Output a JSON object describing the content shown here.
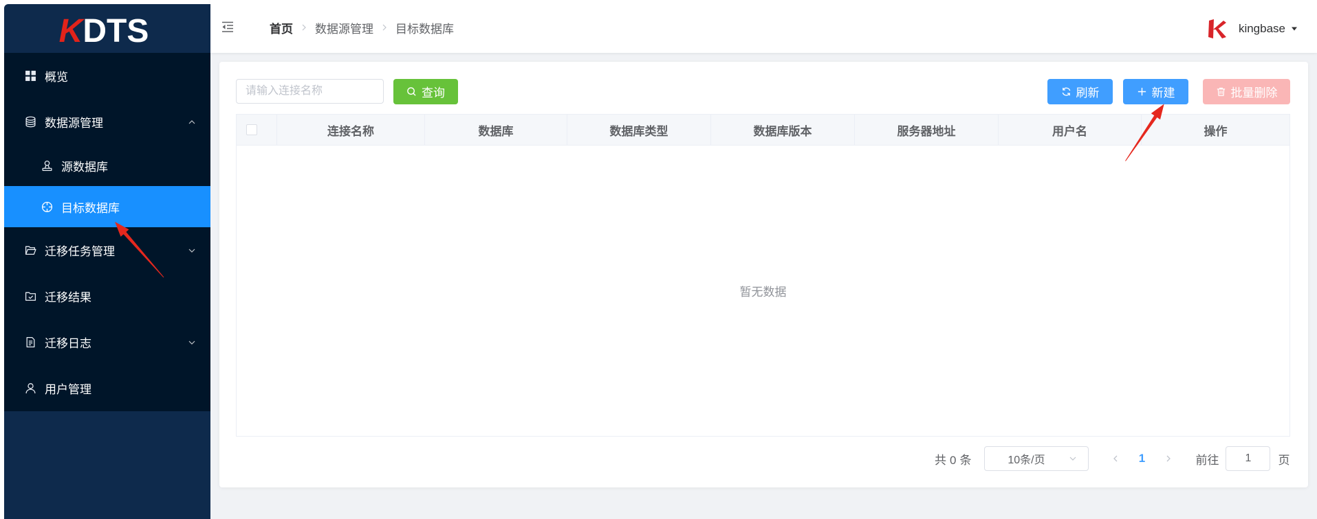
{
  "theme": {
    "sidebar_bg": "#0e2a4c",
    "menu_bg": "#001529",
    "active_bg": "#1890ff",
    "primary": "#409eff",
    "success": "#67c23a",
    "danger_disabled": "#fab6b6",
    "brand_red": "#e2231a",
    "page_bg": "#f0f2f5"
  },
  "sidebar": {
    "logo": {
      "mark": "K",
      "name": "DTS"
    },
    "menu": [
      {
        "label": "概览",
        "icon": "dashboard-grid-icon"
      },
      {
        "label": "数据源管理",
        "icon": "database-icon",
        "expanded": true,
        "indicator_icon": "chevron-up-icon",
        "children": [
          {
            "label": "源数据库",
            "icon": "user-stamp-icon"
          },
          {
            "label": "目标数据库",
            "icon": "aim-target-icon",
            "active": true
          }
        ]
      },
      {
        "label": "迁移任务管理",
        "icon": "folder-opened-icon",
        "expanded": false,
        "indicator_icon": "chevron-down-icon"
      },
      {
        "label": "迁移结果",
        "icon": "folder-checked-icon"
      },
      {
        "label": "迁移日志",
        "icon": "document-icon",
        "expanded": false,
        "indicator_icon": "chevron-down-icon"
      },
      {
        "label": "用户管理",
        "icon": "user-icon"
      }
    ]
  },
  "header": {
    "toggle_icon": "menu-fold-icon",
    "breadcrumb": [
      "首页",
      "数据源管理",
      "目标数据库"
    ],
    "separator_icon": "chevron-right-icon",
    "user": {
      "logo_icon": "kingbase-k-logo-icon",
      "name": "kingbase",
      "dropdown_icon": "caret-down-icon"
    }
  },
  "toolbar": {
    "search": {
      "placeholder": "请输入连接名称",
      "value": ""
    },
    "query": {
      "label": "查询",
      "icon": "search-icon"
    },
    "refresh": {
      "label": "刷新",
      "icon": "refresh-icon"
    },
    "create": {
      "label": "新建",
      "icon": "plus-icon"
    },
    "batch_delete": {
      "label": "批量删除",
      "icon": "delete-icon",
      "disabled": true
    }
  },
  "table": {
    "selection_column": true,
    "columns": [
      "连接名称",
      "数据库",
      "数据库类型",
      "数据库版本",
      "服务器地址",
      "用户名",
      "操作"
    ],
    "rows": [],
    "empty_text": "暂无数据"
  },
  "pagination": {
    "total_prefix": "共",
    "total": 0,
    "total_suffix": "条",
    "page_size": "10条/页",
    "current_page": 1,
    "jump_prefix": "前往",
    "jump_value": "1",
    "jump_suffix": "页"
  }
}
